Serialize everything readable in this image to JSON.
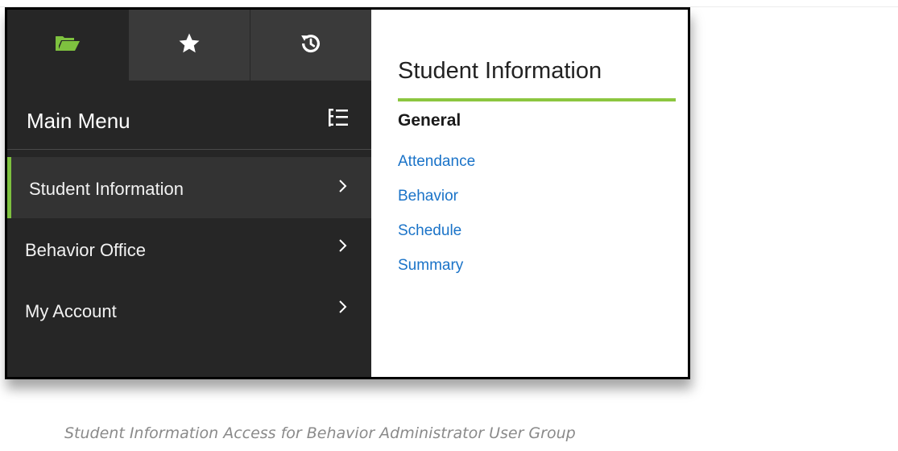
{
  "sidebar": {
    "tabs": [
      {
        "icon": "folder-icon",
        "color": "#7ec13f"
      },
      {
        "icon": "star-icon",
        "color": "#ffffff"
      },
      {
        "icon": "history-icon",
        "color": "#ffffff"
      }
    ],
    "title": "Main Menu",
    "items": [
      {
        "label": "Student Information",
        "active": true
      },
      {
        "label": "Behavior Office",
        "active": false
      },
      {
        "label": "My Account",
        "active": false
      }
    ]
  },
  "panel": {
    "title": "Student Information",
    "section": "General",
    "links": [
      "Attendance",
      "Behavior",
      "Schedule",
      "Summary"
    ]
  },
  "caption": "Student Information Access for Behavior Administrator User Group",
  "colors": {
    "accent": "#7ec13f",
    "link": "#1a73c8",
    "sidebar_bg": "#262626"
  }
}
